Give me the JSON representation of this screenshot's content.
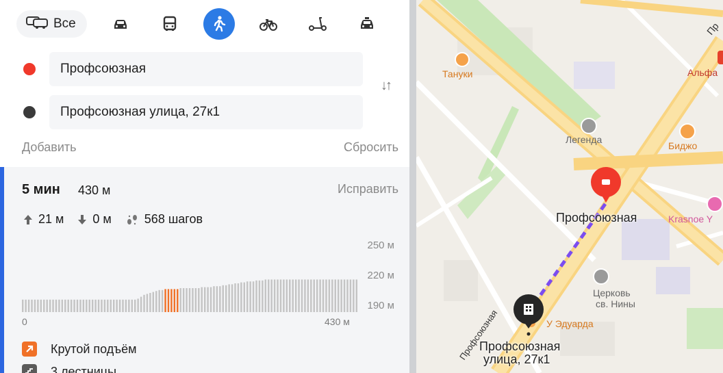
{
  "modes": {
    "all_label": "Все",
    "items": [
      {
        "name": "car",
        "icon": "car-icon"
      },
      {
        "name": "bus",
        "icon": "bus-icon"
      },
      {
        "name": "walk",
        "icon": "pedestrian-icon",
        "active": true
      },
      {
        "name": "bike",
        "icon": "bicycle-icon"
      },
      {
        "name": "scooter",
        "icon": "scooter-icon"
      },
      {
        "name": "taxi",
        "icon": "taxi-icon"
      }
    ],
    "accent_color": "#2c7be5"
  },
  "route": {
    "from": "Профсоюзная",
    "to": "Профсоюзная улица, 27к1",
    "from_color": "#f0392b",
    "to_color": "#3a3a3a",
    "add_label": "Добавить",
    "reset_label": "Сбросить"
  },
  "result": {
    "time": "5 мин",
    "distance": "430 м",
    "fix_label": "Исправить",
    "ascent": "21 м",
    "descent": "0 м",
    "steps": "568 шагов"
  },
  "chart_data": {
    "type": "bar",
    "title": "",
    "xlabel": "",
    "ylabel": "",
    "yticks": [
      "250 м",
      "220 м",
      "190 м"
    ],
    "xticks": [
      "0",
      "430 м"
    ],
    "ylim": [
      175,
      255
    ],
    "xlim": [
      0,
      430
    ],
    "values": [
      188,
      188,
      188,
      188,
      188,
      188,
      188,
      188,
      188,
      188,
      188,
      188,
      188,
      188,
      188,
      188,
      188,
      188,
      188,
      188,
      188,
      188,
      188,
      188,
      188,
      188,
      188,
      188,
      188,
      188,
      188,
      188,
      188,
      188,
      188,
      188,
      188,
      188,
      189,
      191,
      193,
      194,
      195,
      196,
      197,
      198,
      198,
      199,
      199,
      199,
      199,
      199,
      200,
      200,
      200,
      200,
      200,
      200,
      200,
      201,
      201,
      201,
      201,
      202,
      202,
      202,
      203,
      203,
      204,
      204,
      205,
      205,
      206,
      206,
      207,
      207,
      207,
      208,
      208,
      208,
      209,
      209,
      209,
      209,
      209,
      209,
      209,
      209,
      209,
      209,
      209,
      209,
      209,
      209,
      209,
      209,
      209,
      209,
      209,
      209,
      209,
      209,
      209,
      209,
      209,
      209,
      209,
      209,
      209,
      209,
      209
    ],
    "steep_range": [
      47,
      51
    ],
    "bar_color": "#c4c4c4",
    "steep_color": "#f07127"
  },
  "notes": [
    {
      "label": "Крутой подъём",
      "color": "#f07127",
      "icon": "arrow-up-right-icon"
    },
    {
      "label": "3 лестницы",
      "color": "#5a5a5a",
      "icon": "stairs-icon"
    }
  ],
  "map": {
    "labels": {
      "tanuki": "Тануки",
      "alfa": "Альфа",
      "legenda": "Легенда",
      "bijo": "Биджо",
      "station": "Профсоюзная",
      "krasnoe": "Krasnoe Y",
      "church_line1": "Церковь",
      "church_line2": "св. Нины",
      "eduard": "У Эдуарда",
      "dest_line1": "Профсоюзная",
      "dest_line2": "улица, 27к1",
      "street_vertical": "Профсоюзная",
      "street_top": "Пр"
    }
  }
}
